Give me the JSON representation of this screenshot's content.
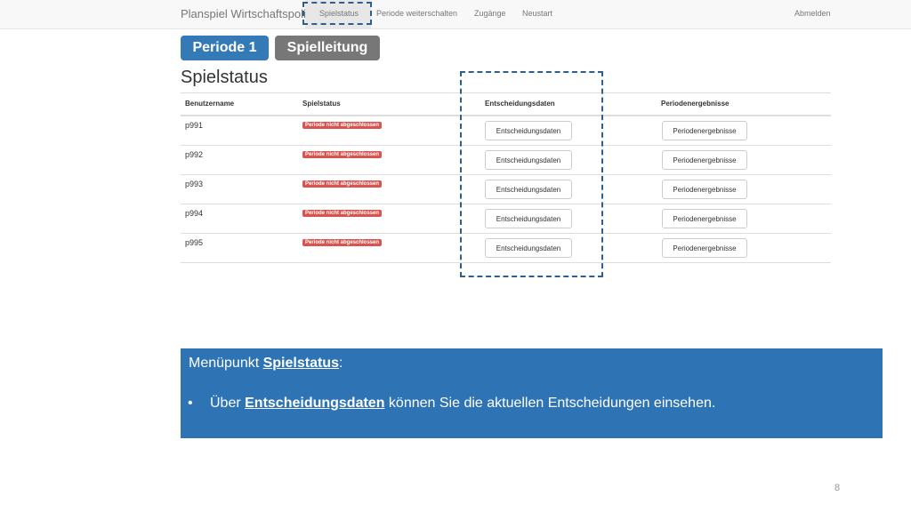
{
  "navbar": {
    "brand": "Planspiel Wirtschaftspolitik",
    "items": [
      {
        "label": "Spielstatus"
      },
      {
        "label": "Periode weiterschalten"
      },
      {
        "label": "Zugänge"
      },
      {
        "label": "Neustart"
      }
    ],
    "logout": "Abmelden"
  },
  "badges": {
    "period": "Periode 1",
    "role": "Spielleitung"
  },
  "page_title": "Spielstatus",
  "table": {
    "headers": [
      "Benutzername",
      "Spielstatus",
      "Entscheidungsdaten",
      "Periodenergebnisse"
    ],
    "rows": [
      {
        "user": "p991",
        "status": "Periode nicht abgeschlossen",
        "decision_button": "Entscheidungsdaten",
        "results_button": "Periodenergebnisse"
      },
      {
        "user": "p992",
        "status": "Periode nicht abgeschlossen",
        "decision_button": "Entscheidungsdaten",
        "results_button": "Periodenergebnisse"
      },
      {
        "user": "p993",
        "status": "Periode nicht abgeschlossen",
        "decision_button": "Entscheidungsdaten",
        "results_button": "Periodenergebnisse"
      },
      {
        "user": "p994",
        "status": "Periode nicht abgeschlossen",
        "decision_button": "Entscheidungsdaten",
        "results_button": "Periodenergebnisse"
      },
      {
        "user": "p995",
        "status": "Periode nicht abgeschlossen",
        "decision_button": "Entscheidungsdaten",
        "results_button": "Periodenergebnisse"
      }
    ]
  },
  "note": {
    "title_prefix": "Menüpunkt ",
    "title_link": "Spielstatus",
    "title_suffix": ":",
    "bullet": "•",
    "text_prefix": "Über ",
    "text_link": "Entscheidungsdaten",
    "text_suffix": " können Sie die aktuellen Entscheidungen einsehen."
  },
  "page_number": "8",
  "colors": {
    "primary": "#337ab7",
    "label_danger": "#d9534f",
    "note_bg": "#2e74b5",
    "highlight_border": "#2e5f8f"
  }
}
